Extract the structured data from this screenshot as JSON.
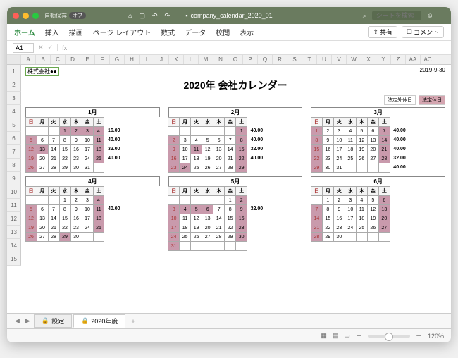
{
  "titlebar": {
    "filename": "company_calendar_2020_01",
    "search_ph": "シートを検索",
    "autosave": "自動保存",
    "off": "オフ"
  },
  "ribbon": {
    "tabs": [
      "ホーム",
      "挿入",
      "描画",
      "ページ レイアウト",
      "数式",
      "データ",
      "校閲",
      "表示"
    ],
    "share": "共有",
    "comment": "コメント"
  },
  "formula": {
    "cell": "A1",
    "fx": "fx"
  },
  "cols": [
    "A",
    "B",
    "C",
    "D",
    "E",
    "F",
    "G",
    "H",
    "I",
    "J",
    "K",
    "L",
    "M",
    "N",
    "O",
    "P",
    "Q",
    "R",
    "S",
    "T",
    "U",
    "V",
    "W",
    "X",
    "Y",
    "Z",
    "AA",
    "AC"
  ],
  "rows": [
    "1",
    "2",
    "3",
    "4",
    "5",
    "6",
    "7",
    "8",
    "9",
    "10",
    "11",
    "12",
    "13",
    "14",
    "15"
  ],
  "sheet": {
    "company": "株式会社●●",
    "date": "2019-9-30",
    "title": "2020年 会社カレンダー",
    "legend": [
      "法定外休日",
      "法定休日"
    ],
    "dow": [
      "日",
      "月",
      "火",
      "水",
      "木",
      "金",
      "土"
    ],
    "months": [
      {
        "name": "1月",
        "start": 3,
        "days": 31,
        "hol": [
          1,
          2,
          3,
          4,
          5,
          11,
          12,
          13,
          18,
          19,
          25,
          26
        ],
        "hours": [
          "16.00",
          "40.00",
          "32.00",
          "40.00",
          ""
        ]
      },
      {
        "name": "2月",
        "start": 6,
        "days": 29,
        "hol": [
          1,
          2,
          8,
          9,
          11,
          15,
          16,
          22,
          23,
          24,
          29
        ],
        "hours": [
          "40.00",
          "40.00",
          "32.00",
          "40.00",
          ""
        ]
      },
      {
        "name": "3月",
        "start": 0,
        "days": 31,
        "hol": [
          1,
          7,
          8,
          14,
          15,
          21,
          22,
          28,
          29
        ],
        "hours": [
          "40.00",
          "40.00",
          "40.00",
          "32.00",
          "40.00"
        ]
      },
      {
        "name": "4月",
        "start": 3,
        "days": 30,
        "hol": [
          4,
          5,
          11,
          12,
          18,
          19,
          25,
          26,
          29
        ],
        "hours": [
          "",
          "40.00",
          "",
          "",
          "",
          ""
        ]
      },
      {
        "name": "5月",
        "start": 5,
        "days": 31,
        "hol": [
          2,
          3,
          4,
          5,
          6,
          9,
          10,
          16,
          17,
          23,
          24,
          30,
          31
        ],
        "hours": [
          "",
          "32.00",
          "",
          "",
          "",
          ""
        ]
      },
      {
        "name": "6月",
        "start": 1,
        "days": 30,
        "hol": [
          6,
          7,
          13,
          14,
          20,
          21,
          27,
          28
        ],
        "hours": [
          "",
          "",
          "",
          "",
          ""
        ]
      }
    ]
  },
  "tabs": {
    "t1": "設定",
    "t2": "2020年度"
  },
  "status": {
    "zoom": "120%"
  }
}
